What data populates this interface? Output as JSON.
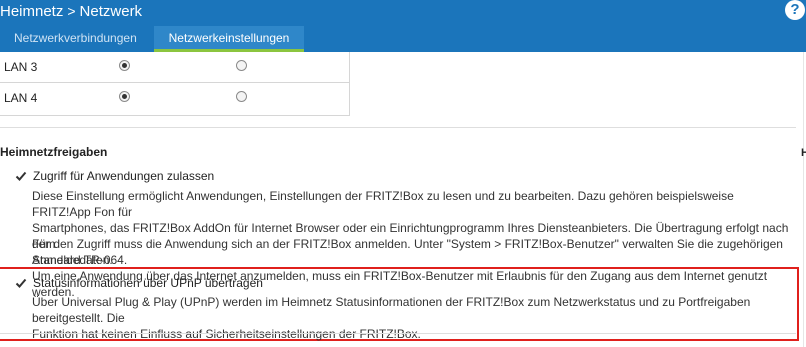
{
  "header": {
    "breadcrumb": [
      "Heimnetz",
      "Netzwerk"
    ],
    "separator": ">",
    "help_label": "?"
  },
  "tabs": [
    {
      "label": "Netzwerkverbindungen",
      "active": false
    },
    {
      "label": "Netzwerkeinstellungen",
      "active": true
    }
  ],
  "lan_ports": [
    {
      "label": "LAN 3",
      "option1_selected": true,
      "option2_selected": false
    },
    {
      "label": "LAN 4",
      "option1_selected": true,
      "option2_selected": false
    }
  ],
  "heimnetzfreigaben": {
    "title": "Heimnetzfreigaben",
    "options": [
      {
        "label": "Zugriff für Anwendungen zulassen",
        "checked": true,
        "desc1": [
          "Diese Einstellung ermöglicht Anwendungen, Einstellungen der FRITZ!Box zu lesen und zu bearbeiten. Dazu gehören beispielsweise FRITZ!App Fon für",
          "Smartphones, das FRITZ!Box AddOn für Internet Browser oder ein Einrichtungprogramm Ihres Diensteanbieters. Die Übertragung erfolgt nach dem",
          "Standard TR-064."
        ],
        "desc2": [
          "Für den Zugriff muss die Anwendung sich an der FRITZ!Box anmelden. Unter \"System > FRITZ!Box-Benutzer\" verwalten Sie die zugehörigen Anmeldedaten.",
          "Um eine Anwendung über das Internet anzumelden, muss ein FRITZ!Box-Benutzer mit Erlaubnis für den Zugang aus dem Internet genutzt werden."
        ]
      },
      {
        "label": "Statusinformationen über UPnP übertragen",
        "checked": true,
        "desc1": [
          "Über Universal Plug & Play (UPnP) werden im Heimnetz Statusinformationen der FRITZ!Box zum Netzwerkstatus und zu Portfreigaben bereitgestellt. Die",
          "Funktion hat keinen Einfluss auf Sicherheitseinstellungen der FRITZ!Box."
        ]
      }
    ]
  },
  "colors": {
    "header_bg": "#1b75bb",
    "active_tab_bg": "#2f87c9",
    "active_tab_underline": "#8bc53f",
    "highlight_border": "#e0201c"
  }
}
